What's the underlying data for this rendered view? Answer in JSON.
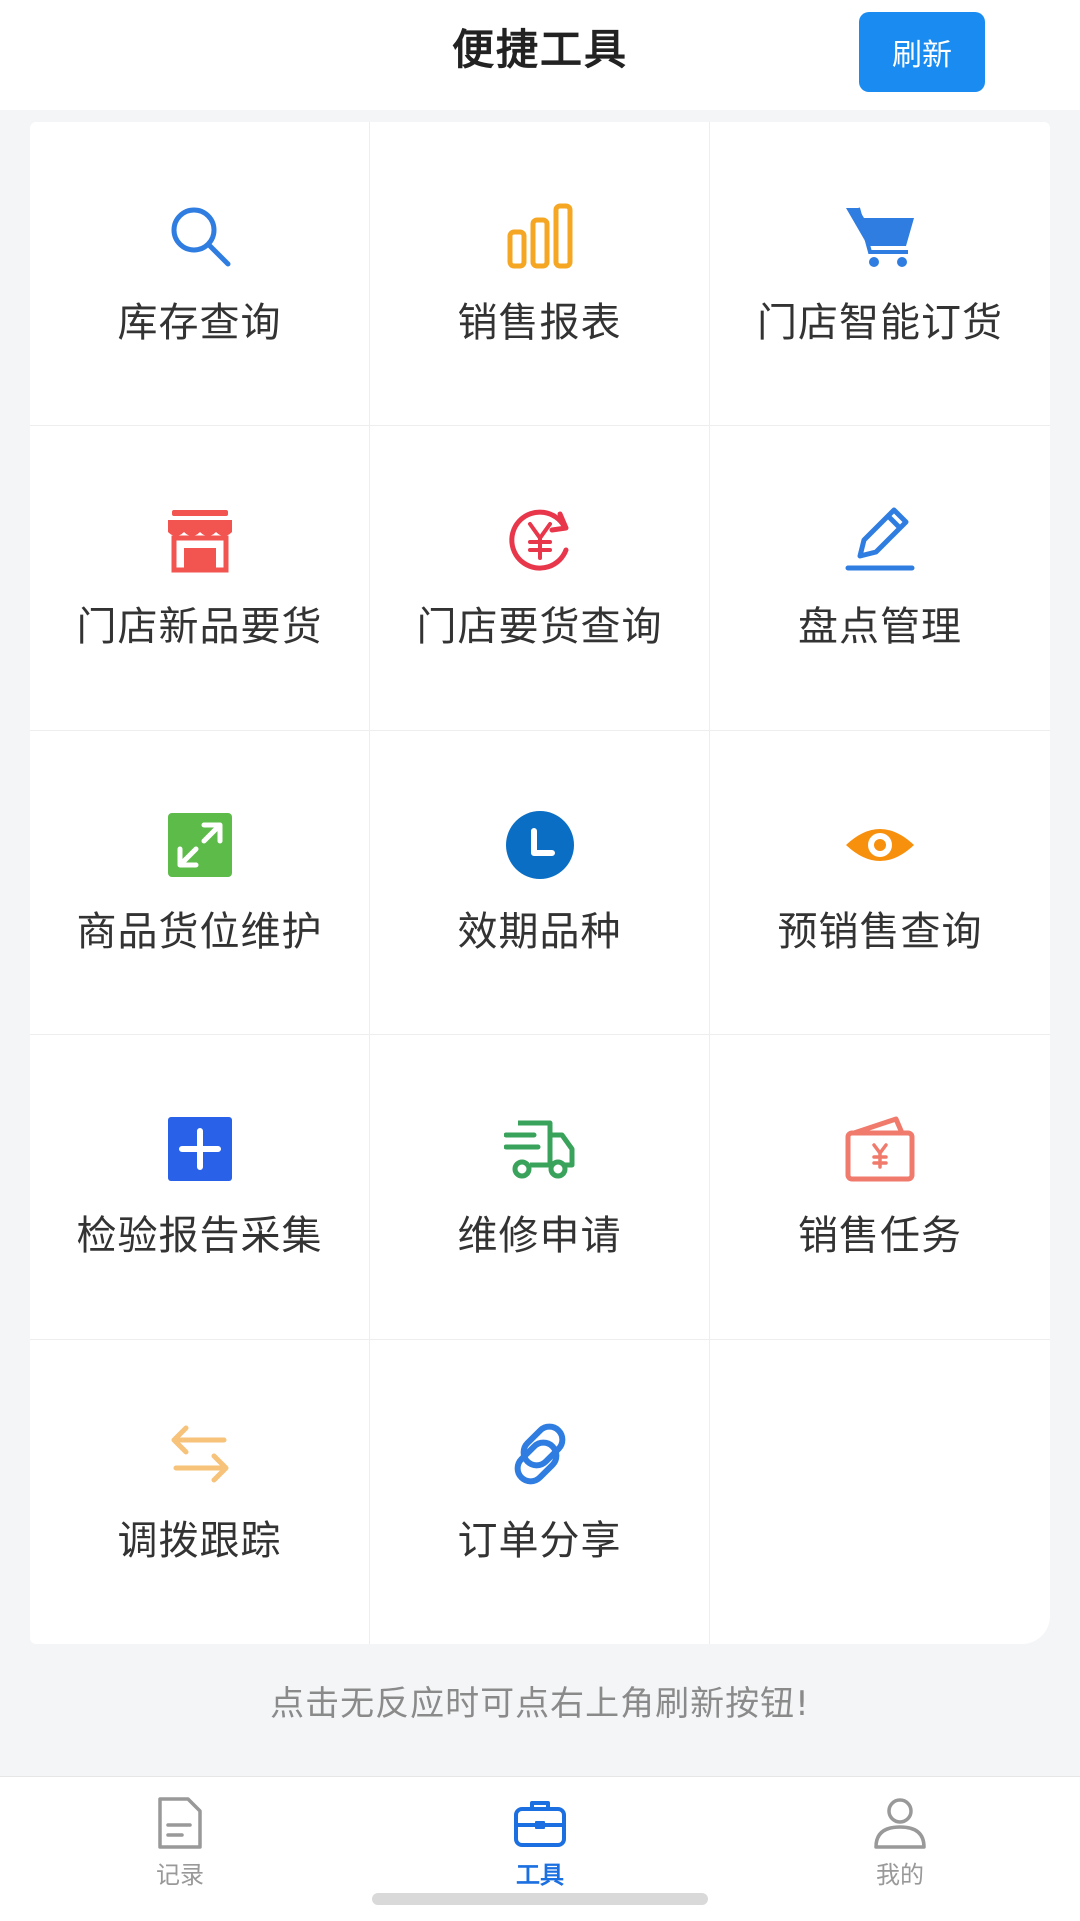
{
  "header": {
    "title": "便捷工具",
    "refresh_label": "刷新"
  },
  "colors": {
    "accent": "#1a8cf1",
    "tab_active": "#1c6fe0",
    "tab_inactive": "#999999"
  },
  "tools": [
    {
      "label": "库存查询",
      "icon": "search-icon",
      "color": "#2f7de1"
    },
    {
      "label": "销售报表",
      "icon": "bar-chart-icon",
      "color": "#f5a623"
    },
    {
      "label": "门店智能订货",
      "icon": "shopping-cart-icon",
      "color": "#2f7de1"
    },
    {
      "label": "门店新品要货",
      "icon": "store-icon",
      "color": "#f25450"
    },
    {
      "label": "门店要货查询",
      "icon": "yen-refresh-icon",
      "color": "#e8364a"
    },
    {
      "label": "盘点管理",
      "icon": "pencil-icon",
      "color": "#2f7de1"
    },
    {
      "label": "商品货位维护",
      "icon": "expand-icon",
      "color": "#5dbb4a"
    },
    {
      "label": "效期品种",
      "icon": "clock-icon",
      "color": "#0a6ec4"
    },
    {
      "label": "预销售查询",
      "icon": "eye-icon",
      "color": "#f7900d"
    },
    {
      "label": "检验报告采集",
      "icon": "plus-square-icon",
      "color": "#2962e8"
    },
    {
      "label": "维修申请",
      "icon": "truck-icon",
      "color": "#3aa35b"
    },
    {
      "label": "销售任务",
      "icon": "wallet-icon",
      "color": "#f07a6c"
    },
    {
      "label": "调拨跟踪",
      "icon": "transfer-arrows-icon",
      "color": "#f7c27a"
    },
    {
      "label": "订单分享",
      "icon": "link-icon",
      "color": "#2f7de1"
    }
  ],
  "hint": "点击无反应时可点右上角刷新按钮!",
  "tabbar": {
    "items": [
      {
        "label": "记录",
        "icon": "document-icon"
      },
      {
        "label": "工具",
        "icon": "toolbox-icon",
        "active": true
      },
      {
        "label": "我的",
        "icon": "user-icon"
      }
    ]
  }
}
